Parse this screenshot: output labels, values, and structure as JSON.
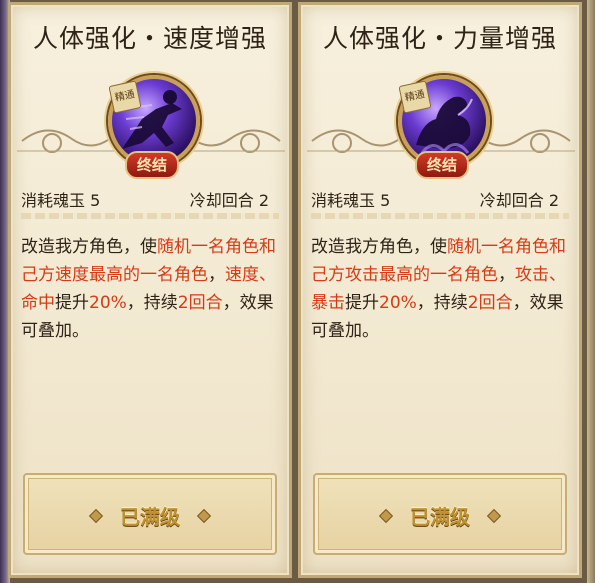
{
  "cards": [
    {
      "title": "人体强化・速度增强",
      "badge_top": "精通",
      "badge_bottom": "终结",
      "cost_label": "消耗魂玉",
      "cost_value": "5",
      "cooldown_label": "冷却回合",
      "cooldown_value": "2",
      "desc": {
        "p1": "改造我方角色，使",
        "h1": "随机一名角色和己方速度最高的一名角色",
        "p2": "，",
        "h2": "速度、命中",
        "p3": "提升",
        "h3": "20%",
        "p4": "，持续",
        "h4": "2回合",
        "p5": "，效果可叠加。"
      },
      "button_label": "已满级",
      "icon": "running-figure-icon"
    },
    {
      "title": "人体强化・力量增强",
      "badge_top": "精通",
      "badge_bottom": "终结",
      "cost_label": "消耗魂玉",
      "cost_value": "5",
      "cooldown_label": "冷却回合",
      "cooldown_value": "2",
      "desc": {
        "p1": "改造我方角色，使",
        "h1": "随机一名角色和己方攻击最高的一名角色",
        "p2": "，",
        "h2": "攻击、暴击",
        "p3": "提升",
        "h3": "20%",
        "p4": "，持续",
        "h4": "2回合",
        "p5": "，效果可叠加。"
      },
      "button_label": "已满级",
      "icon": "flexed-arm-icon"
    }
  ],
  "colors": {
    "highlight": "#d63a17",
    "text": "#2e2316",
    "gold": "#c0922f"
  }
}
